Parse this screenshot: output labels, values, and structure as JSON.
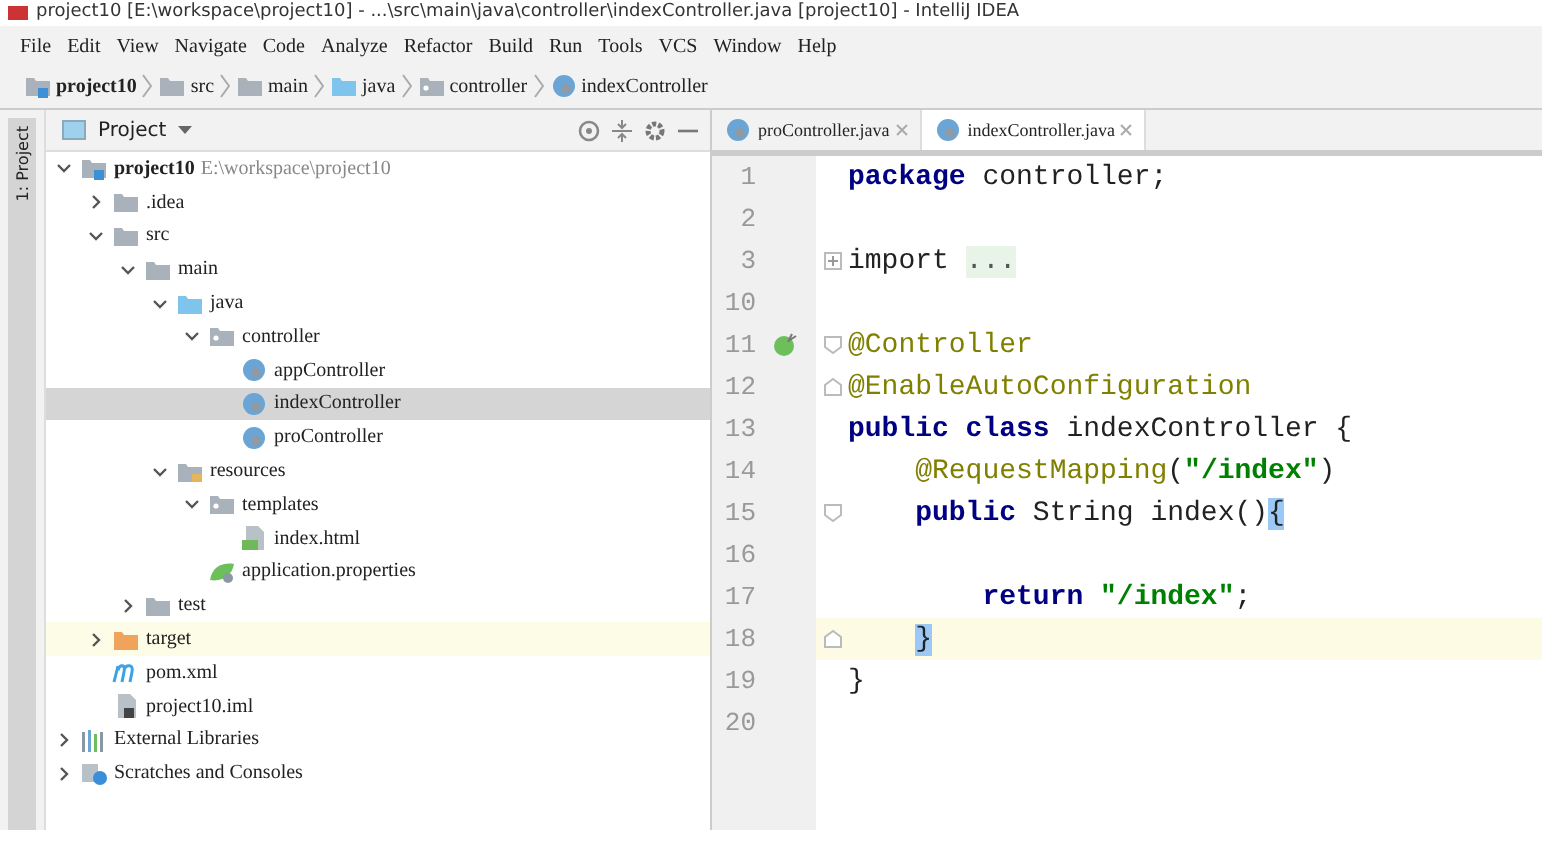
{
  "window": {
    "title": "project10 [E:\\workspace\\project10] - ...\\src\\main\\java\\controller\\indexController.java [project10] - IntelliJ IDEA"
  },
  "menu": [
    "File",
    "Edit",
    "View",
    "Navigate",
    "Code",
    "Analyze",
    "Refactor",
    "Build",
    "Run",
    "Tools",
    "VCS",
    "Window",
    "Help"
  ],
  "breadcrumbs": [
    {
      "label": "project10",
      "kind": "module"
    },
    {
      "label": "src",
      "kind": "folder"
    },
    {
      "label": "main",
      "kind": "folder"
    },
    {
      "label": "java",
      "kind": "source-folder"
    },
    {
      "label": "controller",
      "kind": "package"
    },
    {
      "label": "indexController",
      "kind": "class"
    }
  ],
  "side_strip": {
    "label": "1: Project"
  },
  "project_panel": {
    "title": "Project",
    "tree": [
      {
        "label": "project10",
        "path": "E:\\workspace\\project10",
        "kind": "module",
        "expanded": true,
        "selected": false,
        "highlighted": false,
        "children": [
          {
            "label": ".idea",
            "kind": "folder",
            "expanded": false,
            "selected": false,
            "highlighted": false
          },
          {
            "label": "src",
            "kind": "folder",
            "expanded": true,
            "selected": false,
            "highlighted": false,
            "children": [
              {
                "label": "main",
                "kind": "folder",
                "expanded": true,
                "selected": false,
                "highlighted": false,
                "children": [
                  {
                    "label": "java",
                    "kind": "source-folder",
                    "expanded": true,
                    "selected": false,
                    "highlighted": false,
                    "children": [
                      {
                        "label": "controller",
                        "kind": "package",
                        "expanded": true,
                        "selected": false,
                        "highlighted": false,
                        "children": [
                          {
                            "label": "appController",
                            "kind": "class",
                            "selected": false,
                            "highlighted": false
                          },
                          {
                            "label": "indexController",
                            "kind": "class",
                            "selected": true,
                            "highlighted": false
                          },
                          {
                            "label": "proController",
                            "kind": "class",
                            "selected": false,
                            "highlighted": false
                          }
                        ]
                      }
                    ]
                  },
                  {
                    "label": "resources",
                    "kind": "resource-folder",
                    "expanded": true,
                    "selected": false,
                    "highlighted": false,
                    "children": [
                      {
                        "label": "templates",
                        "kind": "package",
                        "expanded": true,
                        "selected": false,
                        "highlighted": false,
                        "children": [
                          {
                            "label": "index.html",
                            "kind": "html",
                            "selected": false,
                            "highlighted": false
                          }
                        ]
                      },
                      {
                        "label": "application.properties",
                        "kind": "properties",
                        "selected": false,
                        "highlighted": false
                      }
                    ]
                  }
                ]
              },
              {
                "label": "test",
                "kind": "folder",
                "expanded": false,
                "selected": false,
                "highlighted": false
              }
            ]
          },
          {
            "label": "target",
            "kind": "excluded-folder",
            "expanded": false,
            "selected": false,
            "highlighted": true
          },
          {
            "label": "pom.xml",
            "kind": "maven",
            "selected": false,
            "highlighted": false
          },
          {
            "label": "project10.iml",
            "kind": "iml",
            "selected": false,
            "highlighted": false
          }
        ]
      },
      {
        "label": "External Libraries",
        "kind": "libraries",
        "expanded": false,
        "selected": false,
        "highlighted": false
      },
      {
        "label": "Scratches and Consoles",
        "kind": "scratches",
        "expanded": false,
        "selected": false,
        "highlighted": false
      }
    ]
  },
  "editor_tabs": [
    {
      "label": "proController.java",
      "selected": false
    },
    {
      "label": "indexController.java",
      "selected": true
    }
  ],
  "code": [
    {
      "number": "1",
      "current": false,
      "tokens": [
        {
          "text": "package",
          "kind": "keyword"
        },
        {
          "text": " controller;",
          "kind": "plain"
        }
      ]
    },
    {
      "number": "2",
      "current": false
    },
    {
      "number": "3",
      "current": false,
      "fold": {
        "kind": "collapsed"
      },
      "tokens": [
        {
          "text": "import ",
          "kind": "plain"
        },
        {
          "text": "...",
          "kind": "folded"
        }
      ]
    },
    {
      "number": "10",
      "current": false
    },
    {
      "number": "11",
      "current": false,
      "bean_marker": true,
      "fold": {
        "kind": "start"
      },
      "tokens": [
        {
          "text": "@Controller",
          "kind": "annotation"
        }
      ]
    },
    {
      "number": "12",
      "current": false,
      "fold": {
        "kind": "end"
      },
      "tokens": [
        {
          "text": "@EnableAutoConfiguration",
          "kind": "annotation"
        }
      ]
    },
    {
      "number": "13",
      "current": false,
      "tokens": [
        {
          "text": "public class",
          "kind": "keyword"
        },
        {
          "text": " indexController {",
          "kind": "plain"
        }
      ]
    },
    {
      "number": "14",
      "current": false,
      "tokens": [
        {
          "text": "    @RequestMapping",
          "kind": "annotation"
        },
        {
          "text": "(",
          "kind": "plain"
        },
        {
          "text": "\"/index\"",
          "kind": "string"
        },
        {
          "text": ")",
          "kind": "plain"
        }
      ]
    },
    {
      "number": "15",
      "current": false,
      "fold": {
        "kind": "start"
      },
      "tokens": [
        {
          "text": "    public",
          "kind": "keyword"
        },
        {
          "text": " String index()",
          "kind": "plain"
        },
        {
          "text": "{",
          "kind": "brace-match"
        }
      ]
    },
    {
      "number": "16",
      "current": false
    },
    {
      "number": "17",
      "current": false,
      "tokens": [
        {
          "text": "        return",
          "kind": "keyword"
        },
        {
          "text": " \"/index\"",
          "kind": "string"
        },
        {
          "text": ";",
          "kind": "plain"
        }
      ]
    },
    {
      "number": "18",
      "current": true,
      "fold": {
        "kind": "end"
      },
      "tokens": [
        {
          "text": "    }",
          "kind": "brace-match"
        }
      ]
    },
    {
      "number": "19",
      "current": false,
      "tokens": [
        {
          "text": "}",
          "kind": "plain"
        }
      ]
    },
    {
      "number": "20",
      "current": false
    }
  ]
}
